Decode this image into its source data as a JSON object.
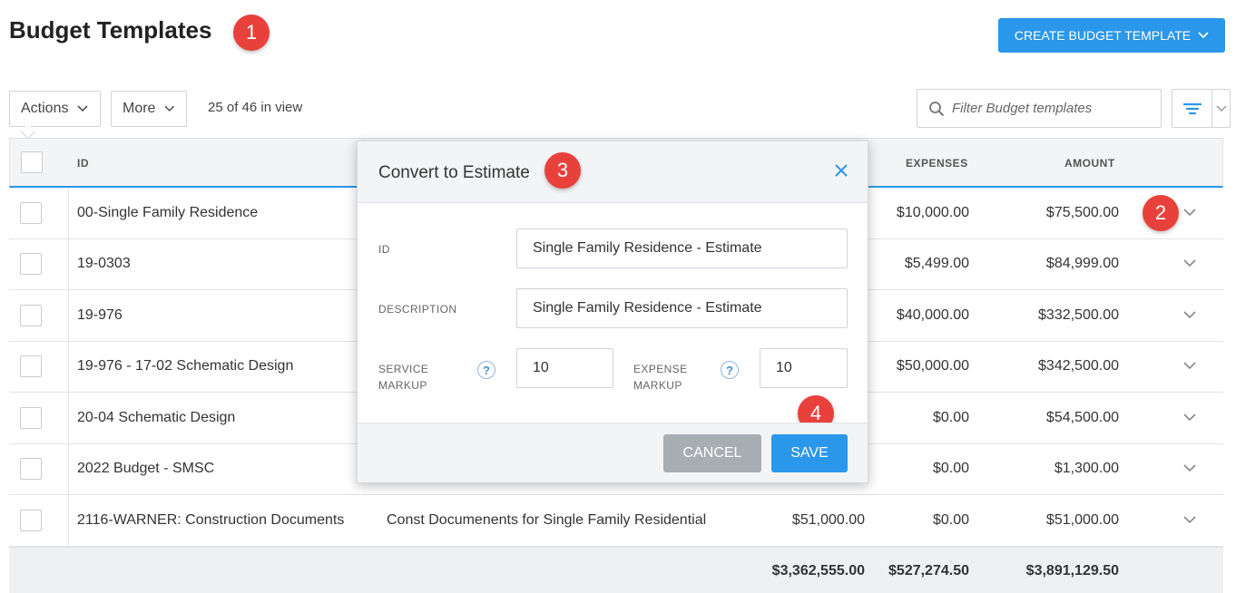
{
  "header": {
    "title": "Budget Templates",
    "create_button": "CREATE BUDGET TEMPLATE"
  },
  "toolbar": {
    "actions_label": "Actions",
    "more_label": "More",
    "in_view": "25 of 46 in view",
    "filter_placeholder": "Filter Budget templates"
  },
  "table": {
    "headers": {
      "id": "ID",
      "expenses": "EXPENSES",
      "amount": "AMOUNT"
    },
    "rows": [
      {
        "id": "00-Single Family Residence",
        "description": "",
        "services": "",
        "expenses": "$10,000.00",
        "amount": "$75,500.00"
      },
      {
        "id": "19-0303",
        "description": "",
        "services": "",
        "expenses": "$5,499.00",
        "amount": "$84,999.00"
      },
      {
        "id": "19-976",
        "description": "",
        "services": "",
        "expenses": "$40,000.00",
        "amount": "$332,500.00"
      },
      {
        "id": "19-976 - 17-02 Schematic Design",
        "description": "",
        "services": "",
        "expenses": "$50,000.00",
        "amount": "$342,500.00"
      },
      {
        "id": "20-04 Schematic Design",
        "description": "",
        "services": "",
        "expenses": "$0.00",
        "amount": "$54,500.00"
      },
      {
        "id": "2022 Budget - SMSC",
        "description": "",
        "services": "",
        "expenses": "$0.00",
        "amount": "$1,300.00"
      },
      {
        "id": "2116-WARNER: Construction Documents",
        "description": "Const Documenents for Single Family Residential",
        "services": "$51,000.00",
        "expenses": "$0.00",
        "amount": "$51,000.00"
      }
    ],
    "totals": {
      "services": "$3,362,555.00",
      "expenses": "$527,274.50",
      "amount": "$3,891,129.50"
    }
  },
  "modal": {
    "title": "Convert to Estimate",
    "id_label": "ID",
    "id_value": "Single Family Residence - Estimate",
    "description_label": "DESCRIPTION",
    "description_value": "Single Family Residence - Estimate",
    "service_markup_label_1": "SERVICE",
    "service_markup_label_2": "MARKUP",
    "service_markup_value": "10",
    "expense_markup_label_1": "EXPENSE",
    "expense_markup_label_2": "MARKUP",
    "expense_markup_value": "10",
    "help_glyph": "?",
    "cancel_label": "CANCEL",
    "save_label": "SAVE"
  },
  "annotations": {
    "badge_1": "1",
    "badge_2": "2",
    "badge_3": "3",
    "badge_4": "4"
  },
  "colors": {
    "accent": "#2a97ea",
    "badge": "#e8413b",
    "cancel": "#a8adb3"
  },
  "icons": {
    "chevron": "chevron-down-icon",
    "search": "search-icon",
    "filter": "filter-icon",
    "close": "close-icon",
    "help": "help-icon"
  }
}
